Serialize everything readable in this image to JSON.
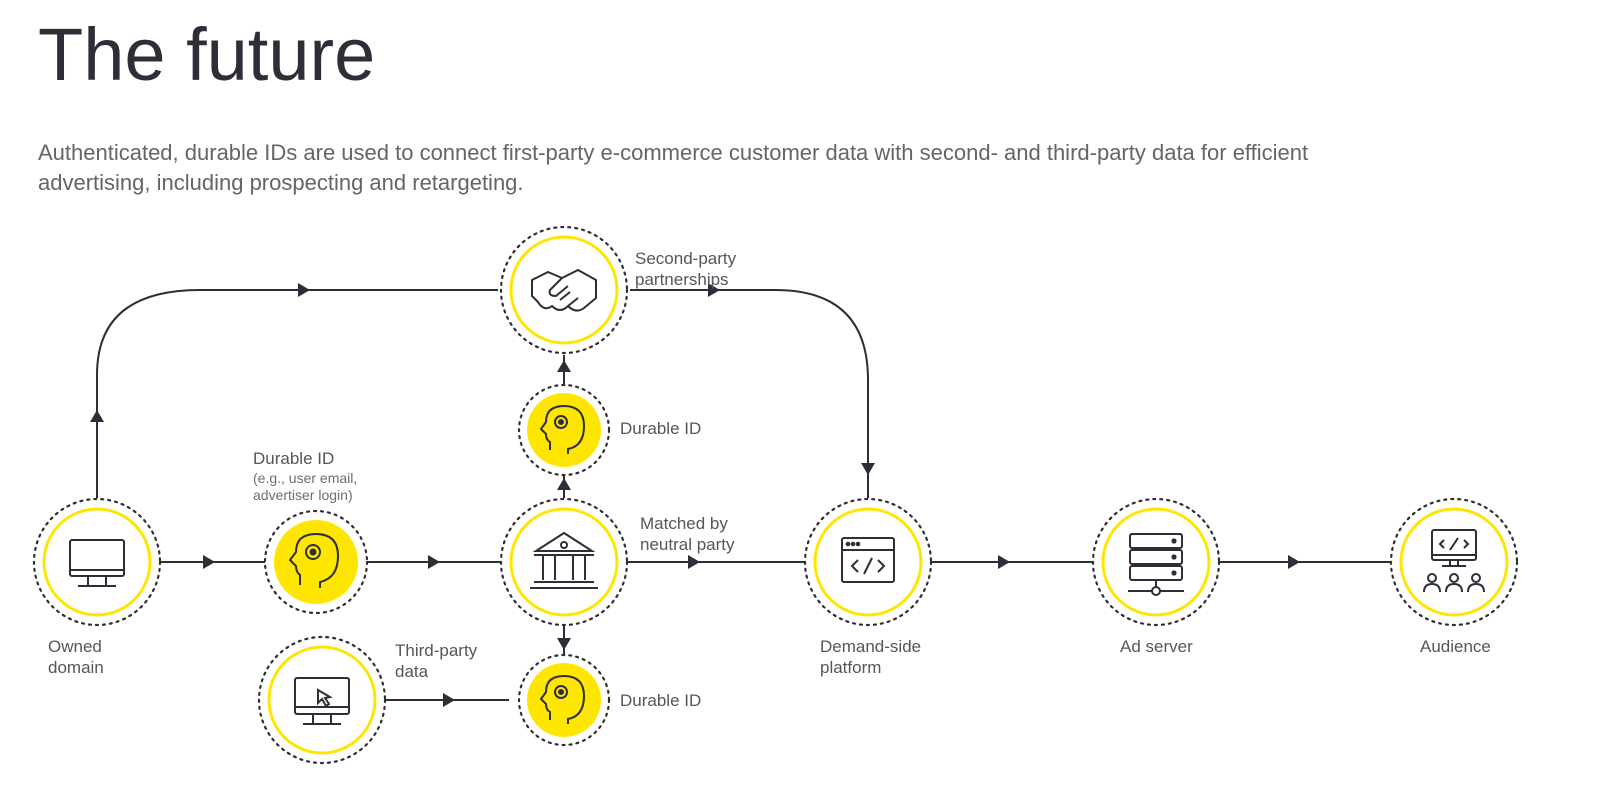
{
  "title": "The future",
  "subtitle": "Authenticated, durable IDs are used to connect first-party e-commerce customer data with second- and third-party data for efficient advertising, including prospecting and retargeting.",
  "nodes": {
    "owned_domain": "Owned\ndomain",
    "durable_id_main": "Durable ID",
    "durable_id_sub": "(e.g., user email,\nadvertiser login)",
    "second_party": "Second-party\npartnerships",
    "durable_id_upper": "Durable ID",
    "matched_neutral": "Matched by\nneutral party",
    "third_party_data": "Third-party\ndata",
    "durable_id_lower": "Durable ID",
    "dsp": "Demand-side\nplatform",
    "ad_server": "Ad server",
    "audience": "Audience"
  },
  "icons": {
    "owned_domain": "monitor-icon",
    "durable_id": "head-profile-icon",
    "second_party": "handshake-icon",
    "matched": "bank-icon",
    "third_party": "monitor-cursor-icon",
    "dsp": "browser-code-icon",
    "ad_server": "server-icon",
    "audience": "monitor-audience-icon"
  },
  "colors": {
    "accent": "#ffe600",
    "line": "#2e2e38",
    "text": "#2e2e38",
    "sub": "#6d6d73"
  }
}
